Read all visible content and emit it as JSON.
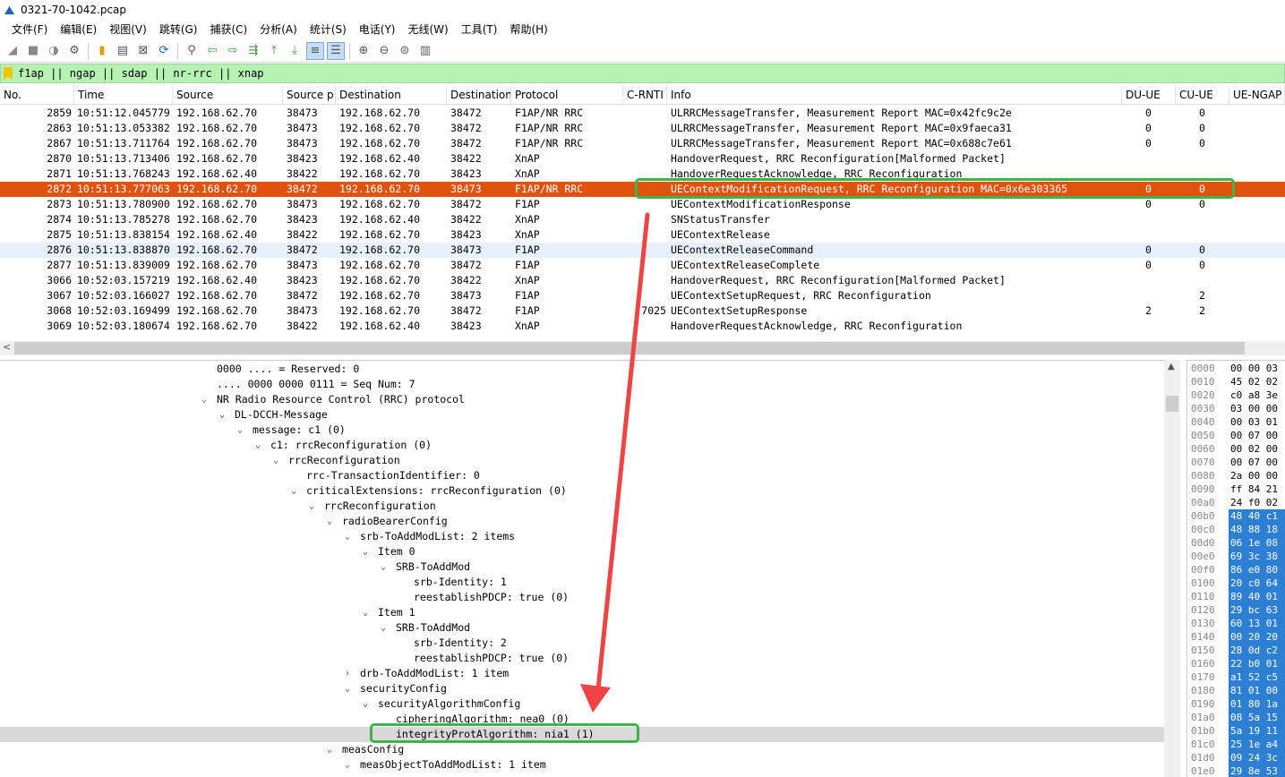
{
  "window": {
    "title": "0321-70-1042.pcap"
  },
  "menu": [
    "文件(F)",
    "编辑(E)",
    "视图(V)",
    "跳转(G)",
    "捕获(C)",
    "分析(A)",
    "统计(S)",
    "电话(Y)",
    "无线(W)",
    "工具(T)",
    "帮助(H)"
  ],
  "filter": {
    "text": "f1ap || ngap || sdap || nr-rrc || xnap"
  },
  "columns": [
    "No.",
    "Time",
    "Source",
    "Source p",
    "Destination",
    "Destination",
    "Protocol",
    "C-RNTI",
    "Info",
    "DU-UE",
    "CU-UE",
    "UE-NGAP"
  ],
  "packets": [
    {
      "no": "2859",
      "time": "10:51:12.045779",
      "src": "192.168.62.70",
      "sport": "38473",
      "dst": "192.168.62.70",
      "dport": "38472",
      "proto": "F1AP/NR RRC",
      "crnti": "",
      "info": "ULRRCMessageTransfer, Measurement Report MAC=0x42fc9c2e",
      "du": "0",
      "cu": "0"
    },
    {
      "no": "2863",
      "time": "10:51:13.053382",
      "src": "192.168.62.70",
      "sport": "38473",
      "dst": "192.168.62.70",
      "dport": "38472",
      "proto": "F1AP/NR RRC",
      "crnti": "",
      "info": "ULRRCMessageTransfer, Measurement Report MAC=0x9faeca31",
      "du": "0",
      "cu": "0"
    },
    {
      "no": "2867",
      "time": "10:51:13.711764",
      "src": "192.168.62.70",
      "sport": "38473",
      "dst": "192.168.62.70",
      "dport": "38472",
      "proto": "F1AP/NR RRC",
      "crnti": "",
      "info": "ULRRCMessageTransfer, Measurement Report MAC=0x688c7e61",
      "du": "0",
      "cu": "0"
    },
    {
      "no": "2870",
      "time": "10:51:13.713406",
      "src": "192.168.62.70",
      "sport": "38423",
      "dst": "192.168.62.40",
      "dport": "38422",
      "proto": "XnAP",
      "crnti": "",
      "info": "HandoverRequest, RRC Reconfiguration[Malformed Packet]",
      "du": "",
      "cu": ""
    },
    {
      "no": "2871",
      "time": "10:51:13.768243",
      "src": "192.168.62.40",
      "sport": "38422",
      "dst": "192.168.62.70",
      "dport": "38423",
      "proto": "XnAP",
      "crnti": "",
      "info": "HandoverRequestAcknowledge, RRC Reconfiguration",
      "du": "",
      "cu": ""
    },
    {
      "no": "2872",
      "time": "10:51:13.777063",
      "src": "192.168.62.70",
      "sport": "38472",
      "dst": "192.168.62.70",
      "dport": "38473",
      "proto": "F1AP/NR RRC",
      "crnti": "",
      "info": "UEContextModificationRequest, RRC Reconfiguration MAC=0x6e303365",
      "du": "0",
      "cu": "0"
    },
    {
      "no": "2873",
      "time": "10:51:13.780900",
      "src": "192.168.62.70",
      "sport": "38473",
      "dst": "192.168.62.70",
      "dport": "38472",
      "proto": "F1AP",
      "crnti": "",
      "info": "UEContextModificationResponse",
      "du": "0",
      "cu": "0"
    },
    {
      "no": "2874",
      "time": "10:51:13.785278",
      "src": "192.168.62.70",
      "sport": "38423",
      "dst": "192.168.62.40",
      "dport": "38422",
      "proto": "XnAP",
      "crnti": "",
      "info": "SNStatusTransfer",
      "du": "",
      "cu": ""
    },
    {
      "no": "2875",
      "time": "10:51:13.838154",
      "src": "192.168.62.40",
      "sport": "38422",
      "dst": "192.168.62.70",
      "dport": "38423",
      "proto": "XnAP",
      "crnti": "",
      "info": "UEContextRelease",
      "du": "",
      "cu": ""
    },
    {
      "no": "2876",
      "time": "10:51:13.838870",
      "src": "192.168.62.70",
      "sport": "38472",
      "dst": "192.168.62.70",
      "dport": "38473",
      "proto": "F1AP",
      "crnti": "",
      "info": "UEContextReleaseCommand",
      "du": "0",
      "cu": "0"
    },
    {
      "no": "2877",
      "time": "10:51:13.839009",
      "src": "192.168.62.70",
      "sport": "38473",
      "dst": "192.168.62.70",
      "dport": "38472",
      "proto": "F1AP",
      "crnti": "",
      "info": "UEContextReleaseComplete",
      "du": "0",
      "cu": "0"
    },
    {
      "no": "3066",
      "time": "10:52:03.157219",
      "src": "192.168.62.40",
      "sport": "38423",
      "dst": "192.168.62.70",
      "dport": "38422",
      "proto": "XnAP",
      "crnti": "",
      "info": "HandoverRequest, RRC Reconfiguration[Malformed Packet]",
      "du": "",
      "cu": ""
    },
    {
      "no": "3067",
      "time": "10:52:03.166027",
      "src": "192.168.62.70",
      "sport": "38472",
      "dst": "192.168.62.70",
      "dport": "38473",
      "proto": "F1AP",
      "crnti": "",
      "info": "UEContextSetupRequest, RRC Reconfiguration",
      "du": "",
      "cu": "2"
    },
    {
      "no": "3068",
      "time": "10:52:03.169499",
      "src": "192.168.62.70",
      "sport": "38473",
      "dst": "192.168.62.70",
      "dport": "38472",
      "proto": "F1AP",
      "crnti": "7025",
      "info": "UEContextSetupResponse",
      "du": "2",
      "cu": "2"
    },
    {
      "no": "3069",
      "time": "10:52:03.180674",
      "src": "192.168.62.70",
      "sport": "38422",
      "dst": "192.168.62.40",
      "dport": "38423",
      "proto": "XnAP",
      "crnti": "",
      "info": "HandoverRequestAcknowledge, RRC Reconfiguration",
      "du": "",
      "cu": ""
    }
  ],
  "tree": [
    {
      "text": "0000 .... = Reserved: 0",
      "toggle": ""
    },
    {
      "text": ".... 0000 0000 0111 = Seq Num: 7",
      "toggle": ""
    },
    {
      "text": "NR Radio Resource Control (RRC) protocol",
      "toggle": "v"
    },
    {
      "text": "DL-DCCH-Message",
      "toggle": "v"
    },
    {
      "text": "message: c1 (0)",
      "toggle": "v"
    },
    {
      "text": "c1: rrcReconfiguration (0)",
      "toggle": "v"
    },
    {
      "text": "rrcReconfiguration",
      "toggle": "v"
    },
    {
      "text": "rrc-TransactionIdentifier: 0",
      "toggle": ""
    },
    {
      "text": "criticalExtensions: rrcReconfiguration (0)",
      "toggle": "v"
    },
    {
      "text": "rrcReconfiguration",
      "toggle": "v"
    },
    {
      "text": "radioBearerConfig",
      "toggle": "v"
    },
    {
      "text": "srb-ToAddModList: 2 items",
      "toggle": "v"
    },
    {
      "text": "Item 0",
      "toggle": "v"
    },
    {
      "text": "SRB-ToAddMod",
      "toggle": "v"
    },
    {
      "text": "srb-Identity: 1",
      "toggle": ""
    },
    {
      "text": "reestablishPDCP: true (0)",
      "toggle": ""
    },
    {
      "text": "Item 1",
      "toggle": "v"
    },
    {
      "text": "SRB-ToAddMod",
      "toggle": "v"
    },
    {
      "text": "srb-Identity: 2",
      "toggle": ""
    },
    {
      "text": "reestablishPDCP: true (0)",
      "toggle": ""
    },
    {
      "text": "drb-ToAddModList: 1 item",
      "toggle": ">"
    },
    {
      "text": "securityConfig",
      "toggle": "v"
    },
    {
      "text": "securityAlgorithmConfig",
      "toggle": "v"
    },
    {
      "text": "cipheringAlgorithm: nea0 (0)",
      "toggle": ""
    },
    {
      "text": "integrityProtAlgorithm: nia1 (1)",
      "toggle": ""
    },
    {
      "text": "measConfig",
      "toggle": "v"
    },
    {
      "text": "measObjectToAddModList: 1 item",
      "toggle": "v"
    }
  ],
  "hex": [
    {
      "off": "0000",
      "b": "00 00 03"
    },
    {
      "off": "0010",
      "b": "45 02 02"
    },
    {
      "off": "0020",
      "b": "c0 a8 3e"
    },
    {
      "off": "0030",
      "b": "03 00 00"
    },
    {
      "off": "0040",
      "b": "00 03 01"
    },
    {
      "off": "0050",
      "b": "00 07 00"
    },
    {
      "off": "0060",
      "b": "00 02 00"
    },
    {
      "off": "0070",
      "b": "00 07 00"
    },
    {
      "off": "0080",
      "b": "2a 00 00"
    },
    {
      "off": "0090",
      "b": "ff 84 21"
    },
    {
      "off": "00a0",
      "b": "24 f0 02"
    },
    {
      "off": "00b0",
      "b": "48 40 c1"
    },
    {
      "off": "00c0",
      "b": "48 88 18"
    },
    {
      "off": "00d0",
      "b": "06 1e 08"
    },
    {
      "off": "00e0",
      "b": "69 3c 38"
    },
    {
      "off": "00f0",
      "b": "86 e0 80"
    },
    {
      "off": "0100",
      "b": "20 c0 64"
    },
    {
      "off": "0110",
      "b": "89 40 01"
    },
    {
      "off": "0120",
      "b": "29 bc 63"
    },
    {
      "off": "0130",
      "b": "60 13 01"
    },
    {
      "off": "0140",
      "b": "00 20 20"
    },
    {
      "off": "0150",
      "b": "28 0d c2"
    },
    {
      "off": "0160",
      "b": "22 b0 01"
    },
    {
      "off": "0170",
      "b": "a1 52 c5"
    },
    {
      "off": "0180",
      "b": "81 01 00"
    },
    {
      "off": "0190",
      "b": "01 80 1a"
    },
    {
      "off": "01a0",
      "b": "08 5a 15"
    },
    {
      "off": "01b0",
      "b": "5a 19 11"
    },
    {
      "off": "01c0",
      "b": "25 1e a4"
    },
    {
      "off": "01d0",
      "b": "09 24 3c"
    },
    {
      "off": "01e0",
      "b": "29 8e 53"
    }
  ],
  "colors": {
    "selected_row": "#e0530e",
    "filter_bg": "#b6f2b2",
    "hex_highlight": "#2d7fd3",
    "annotation_box": "#3cb44a",
    "annotation_arrow": "#ef4444"
  }
}
